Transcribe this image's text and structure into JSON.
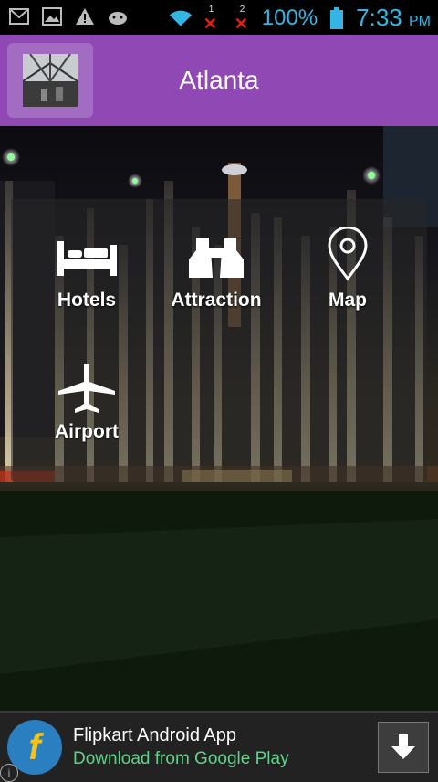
{
  "status_bar": {
    "battery_percent": "100%",
    "time": "7:33",
    "ampm": "PM",
    "sim1": "1",
    "sim2": "2",
    "icons": [
      "gmail-icon",
      "image-icon",
      "warning-icon",
      "android-icon",
      "wifi-icon",
      "signal-x-icon",
      "battery-icon"
    ]
  },
  "header": {
    "title": "Atlanta"
  },
  "menu": {
    "items": [
      {
        "label": "Hotels",
        "icon": "bed-icon"
      },
      {
        "label": "Attraction",
        "icon": "binoculars-icon"
      },
      {
        "label": "Map",
        "icon": "map-pin-icon"
      },
      {
        "label": "Airport",
        "icon": "airplane-icon"
      }
    ]
  },
  "ad": {
    "title": "Flipkart Android App",
    "subtitle": "Download from Google Play",
    "logo_letter": "f",
    "info": "i",
    "accent_color": "#5fd38a"
  },
  "colors": {
    "header": "#9048b4",
    "status_text": "#33b5e5"
  }
}
